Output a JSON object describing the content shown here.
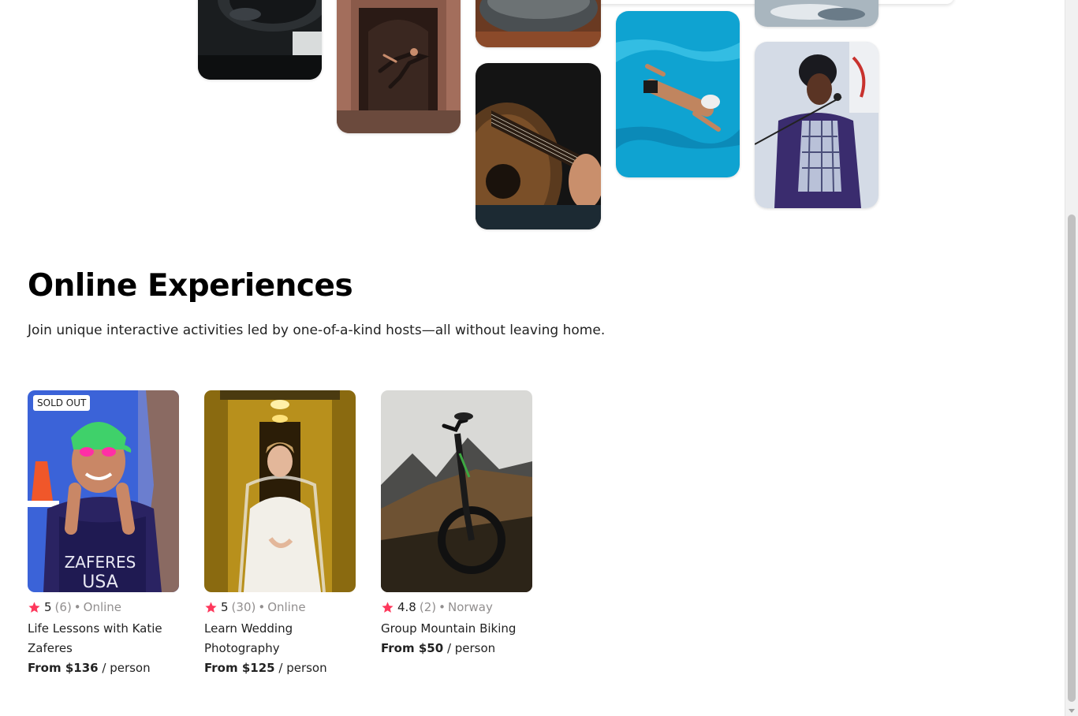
{
  "section": {
    "title": "Online Experiences",
    "subtitle": "Join unique interactive activities led by one-of-a-kind hosts—all without leaving home."
  },
  "accent_color": "#fe385c",
  "cards": [
    {
      "badge": "SOLD OUT",
      "rating": "5",
      "review_count": "(6)",
      "separator": "•",
      "location": "Online",
      "title": "Life Lessons with Katie Zaferes",
      "price_label": "From $136",
      "price_unit": "/ person"
    },
    {
      "badge": "",
      "rating": "5",
      "review_count": "(30)",
      "separator": "•",
      "location": "Online",
      "title": "Learn Wedding Photography",
      "price_label": "From $125",
      "price_unit": "/ person"
    },
    {
      "badge": "",
      "rating": "4.8",
      "review_count": "(2)",
      "separator": "•",
      "location": "Norway",
      "title": "Group Mountain Biking",
      "price_label": "From $50",
      "price_unit": "/ person"
    }
  ],
  "card_image_text": {
    "jersey_line1": "ZAFERES",
    "jersey_line2": "USA"
  }
}
